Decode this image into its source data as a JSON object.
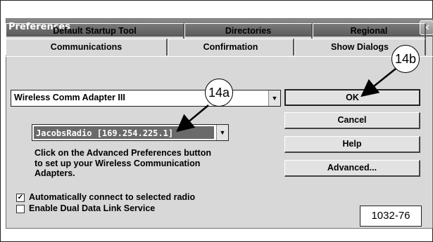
{
  "dialog": {
    "title": "Preferences",
    "close_glyph": "×"
  },
  "tabs": {
    "back_row": [
      "Default Startup Tool",
      "Directories",
      "Regional"
    ],
    "front_row": [
      "Communications",
      "Confirmation",
      "Show Dialogs"
    ],
    "active": "Communications"
  },
  "adapter_select": {
    "value": "Wireless Comm Adapter III"
  },
  "radio_select": {
    "value": "JacobsRadio [169.254.225.1]"
  },
  "info_text": "Click on the Advanced Preferences button to set up your Wireless Communication Adapters.",
  "buttons": {
    "ok": "OK",
    "cancel": "Cancel",
    "help": "Help",
    "advanced": "Advanced..."
  },
  "checkboxes": {
    "auto_connect": {
      "label": "Automatically connect to selected radio",
      "checked": true,
      "mark": "✓"
    },
    "dual_data_link": {
      "label": "Enable Dual Data Link Service",
      "checked": false,
      "mark": ""
    }
  },
  "annotations": {
    "callout_a": "14a",
    "callout_b": "14b",
    "figure_id": "1032-76"
  },
  "icons": {
    "dropdown": "chevron-down-icon",
    "close": "close-icon",
    "check": "check-icon"
  }
}
